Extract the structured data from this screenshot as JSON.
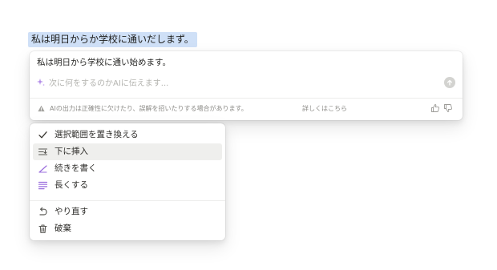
{
  "document": {
    "selected_text": "私は明日からか学校に通いだしまず。"
  },
  "ai_panel": {
    "result_text": "私は明日から学校に通い始めます。",
    "input": {
      "value": "",
      "placeholder": "次に何をするのかAIに伝えます..."
    },
    "send_icon": "arrow-up-icon",
    "footer": {
      "warning_icon": "warning-triangle-icon",
      "disclaimer": "AIの出力は正確性に欠けたり、誤解を招いたりする場合があります。",
      "learn_more": "詳しくはこちら",
      "feedback_icons": [
        "thumbs-up-icon",
        "thumbs-down-icon"
      ]
    }
  },
  "menu": {
    "highlighted_index": 1,
    "group1": [
      {
        "label": "選択範囲を置き換える",
        "icon": "check-icon"
      },
      {
        "label": "下に挿入",
        "icon": "insert-below-icon"
      },
      {
        "label": "続きを書く",
        "icon": "pen-icon"
      },
      {
        "label": "長くする",
        "icon": "lines-icon"
      }
    ],
    "group2": [
      {
        "label": "やり直す",
        "icon": "retry-icon"
      },
      {
        "label": "破棄",
        "icon": "trash-icon"
      }
    ]
  },
  "colors": {
    "selection_highlight": "#cfe0f7",
    "accent_purple": "#9a6ddd"
  }
}
